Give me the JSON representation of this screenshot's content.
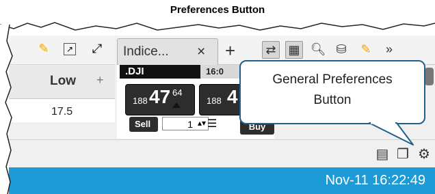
{
  "heading": "Preferences Button",
  "left_panel": {
    "toolbar_icons": [
      "pencil-icon",
      "popout-icon",
      "expand-icon"
    ],
    "column_header": "Low",
    "column_add": "+",
    "row_value": "17.5"
  },
  "right_panel": {
    "tab_label": "Indice...",
    "tab_close": "×",
    "tab_add": "+",
    "toolbar_icons": [
      "link-icon",
      "grid-icon",
      "search-plus-icon",
      "database-plus-icon",
      "pencil-icon",
      "chevrons-right-icon"
    ],
    "ticker": {
      "symbol": ".DJI",
      "time": "16:0",
      "bid_prefix": "188",
      "bid_big": "47",
      "bid_sup": "64",
      "ask_prefix": "188",
      "ask_big": "4",
      "sell_label": "Sell",
      "quantity": "1",
      "buy_label": "Buy"
    }
  },
  "bottom_toolbar_icons": [
    "layout-icon",
    "copy-icon",
    "gear-icon"
  ],
  "status_datetime": "Nov-11 16:22:49",
  "callout_text_line1": "General Preferences",
  "callout_text_line2": "Button",
  "colors": {
    "status_bar": "#1e9ad6",
    "callout_border": "#1f5f8b",
    "pencil": "#f0a500"
  }
}
